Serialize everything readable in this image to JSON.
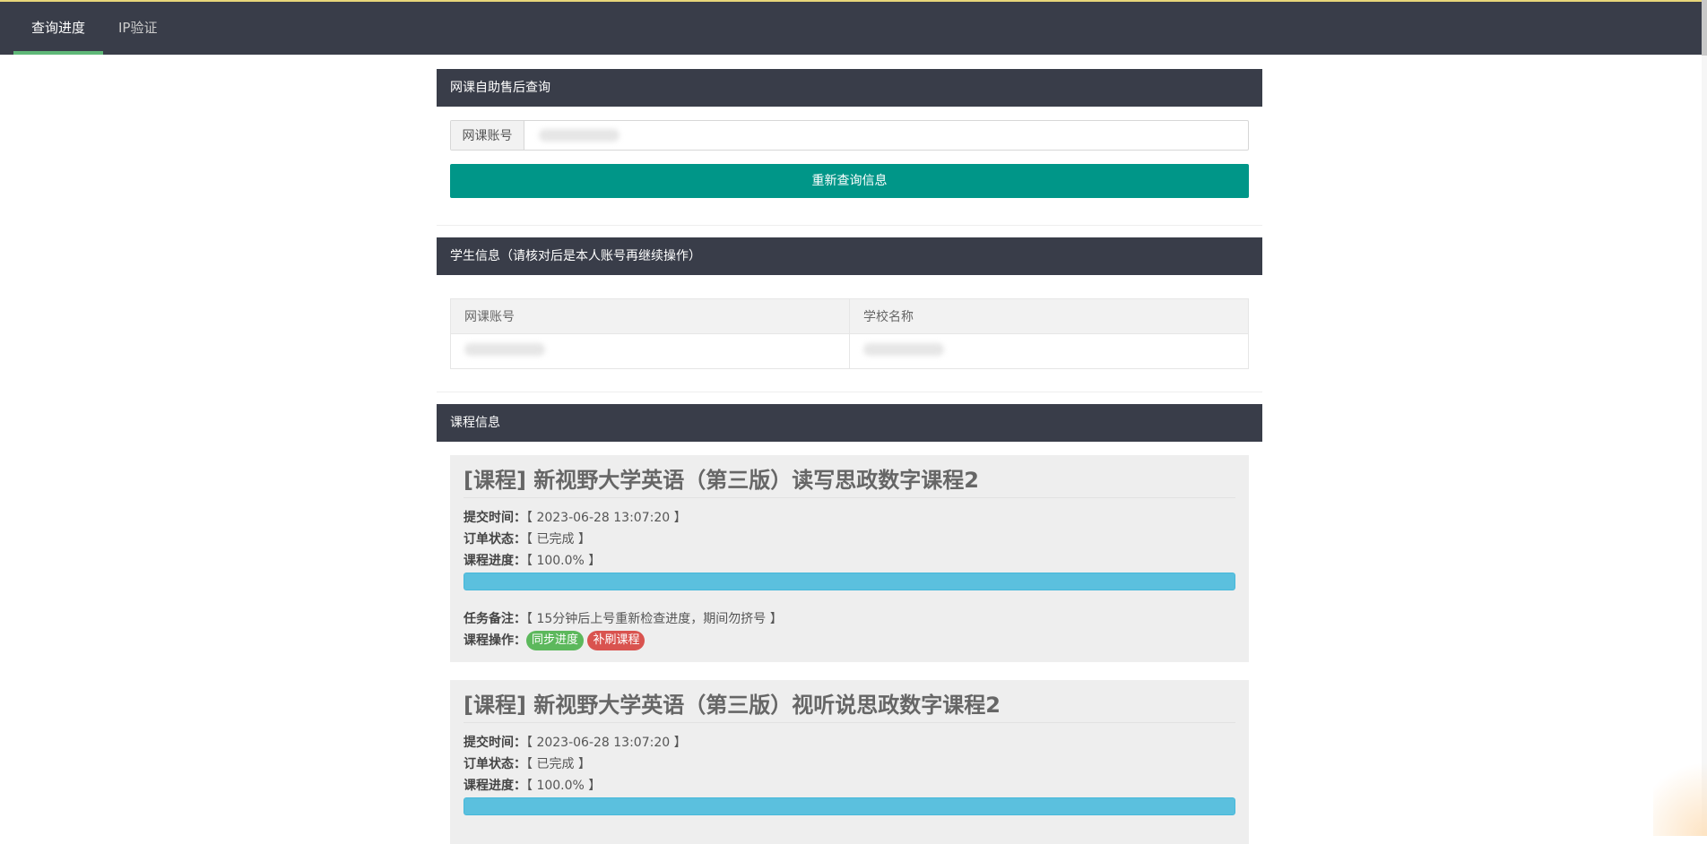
{
  "nav": {
    "tabs": [
      {
        "label": "查询进度",
        "active": true
      },
      {
        "label": "IP验证",
        "active": false
      }
    ]
  },
  "query_panel": {
    "title": "网课自助售后查询",
    "input_label": "网课账号",
    "input_value": "",
    "button_label": "重新查询信息"
  },
  "student_panel": {
    "title": "学生信息（请核对后是本人账号再继续操作）",
    "columns": [
      "网课账号",
      "学校名称"
    ]
  },
  "course_panel": {
    "title": "课程信息",
    "courses": [
      {
        "title": "[课程] 新视野大学英语（第三版）读写思政数字课程2",
        "submit_label": "提交时间：",
        "submit_time": "【 2023-06-28 13:07:20 】",
        "status_label": "订单状态：",
        "status": "【 已完成 】",
        "progress_label": "课程进度：",
        "progress_text": "【 100.0% 】",
        "progress": 1.0,
        "note_label": "任务备注：",
        "note": "【 15分钟后上号重新检查进度，期间勿挤号 】",
        "ops_label": "课程操作：",
        "sync_button": "同步进度",
        "refill_button": "补刷课程"
      },
      {
        "title": "[课程] 新视野大学英语（第三版）视听说思政数字课程2",
        "submit_label": "提交时间：",
        "submit_time": "【 2023-06-28 13:07:20 】",
        "status_label": "订单状态：",
        "status": "【 已完成 】",
        "progress_label": "课程进度：",
        "progress_text": "【 100.0% 】",
        "progress": 1.0
      }
    ]
  },
  "colors": {
    "nav_bg": "#393d49",
    "accent_green": "#009688",
    "tab_indicator": "#5fb878",
    "progress_bar": "#5bc0de",
    "tag_green": "#5cb85c",
    "tag_red": "#d9534f"
  }
}
